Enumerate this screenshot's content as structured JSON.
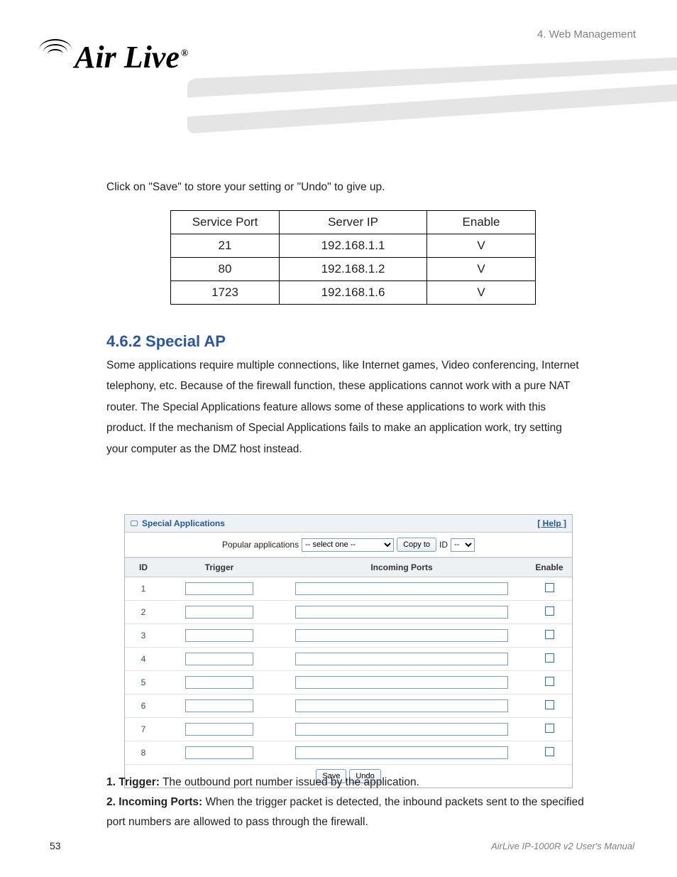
{
  "chapter_label": "4. Web Management",
  "logo_text": "Air Live",
  "logo_trademark": "®",
  "intro_para": "Click on \"Save\" to store your setting or \"Undo\" to give up.",
  "simple_table": {
    "headers": [
      "Service Port",
      "Server IP",
      "Enable"
    ],
    "rows": [
      {
        "port": "21",
        "ip": "192.168.1.1",
        "en": "V"
      },
      {
        "port": "80",
        "ip": "192.168.1.2",
        "en": "V"
      },
      {
        "port": "1723",
        "ip": "192.168.1.6",
        "en": "V"
      }
    ]
  },
  "section_heading": "4.6.2 Special AP",
  "section_para": "Some applications require multiple connections, like Internet games, Video conferencing, Internet telephony, etc. Because of the firewall function, these applications cannot work with a pure NAT router. The Special Applications feature allows some of these applications to work with this product. If the mechanism of Special Applications fails to make an application work, try setting your computer as the DMZ host instead.",
  "panel": {
    "title": "Special Applications",
    "help": "[ Help ]",
    "popular_label": "Popular applications",
    "popular_select": "-- select one --",
    "copy_button": "Copy to",
    "id_label": "ID",
    "id_select": "--",
    "columns": [
      "ID",
      "Trigger",
      "Incoming Ports",
      "Enable"
    ],
    "rows": [
      {
        "id": "1"
      },
      {
        "id": "2"
      },
      {
        "id": "3"
      },
      {
        "id": "4"
      },
      {
        "id": "5"
      },
      {
        "id": "6"
      },
      {
        "id": "7"
      },
      {
        "id": "8"
      }
    ],
    "save": "Save",
    "undo": "Undo"
  },
  "bullets": {
    "b1_label": "1. Trigger:",
    "b1_text": " The outbound port number issued by the application.",
    "b2_label": "2. Incoming Ports:",
    "b2_text": " When the trigger packet is detected, the inbound packets sent to the specified port numbers are allowed to pass through the firewall."
  },
  "page_number": "53",
  "footer": "AirLive IP-1000R v2 User's Manual"
}
